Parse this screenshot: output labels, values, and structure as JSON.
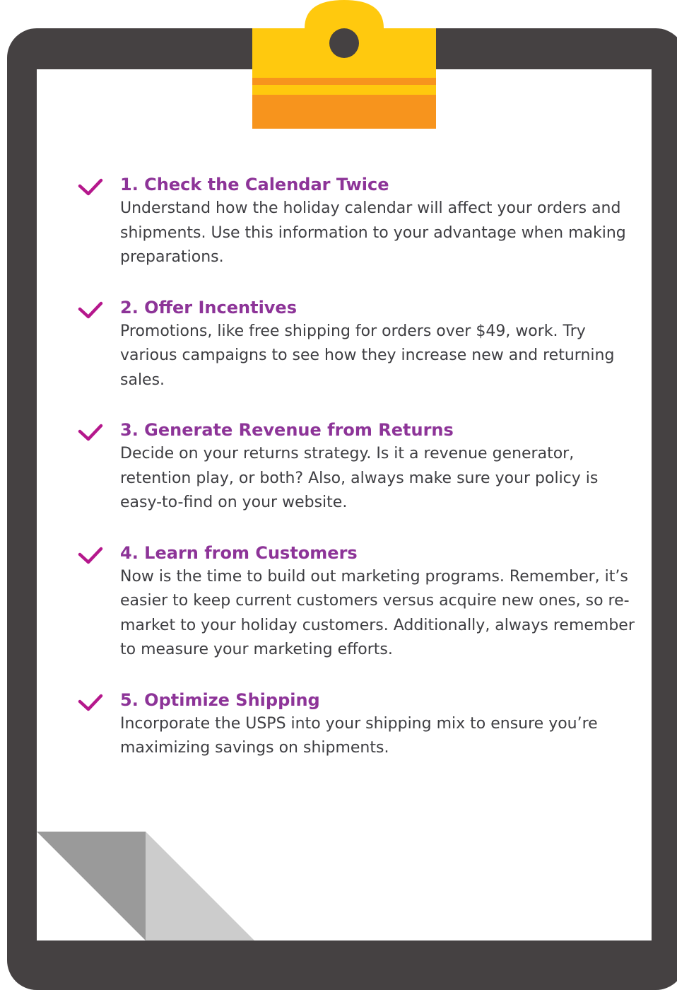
{
  "colors": {
    "board": "#454142",
    "paper": "#ffffff",
    "clip_yellow": "#ffc90e",
    "clip_orange": "#f7941d",
    "title_purple": "#8d3498",
    "check_magenta": "#b5178c",
    "body_text": "#3e3e42",
    "fold_dark": "#9a9a9a",
    "fold_light": "#cccccc"
  },
  "icons": {
    "check": "checkmark-icon"
  },
  "checklist": [
    {
      "title": "1. Check the Calendar Twice",
      "body": "Understand how the holiday calendar will affect your orders and shipments. Use this information to your advantage when making preparations."
    },
    {
      "title": "2. Offer Incentives",
      "body": "Promotions, like free shipping for orders over $49, work. Try various campaigns to see how they increase new and returning sales."
    },
    {
      "title": "3. Generate Revenue from Returns",
      "body": "Decide on your returns strategy. Is it a revenue generator, retention play, or both? Also, always make sure your policy is easy-to-find on your website."
    },
    {
      "title": "4. Learn from Customers",
      "body": "Now is the time to build out marketing programs. Remember, it’s easier to keep current customers versus acquire new ones, so re-market to your holiday customers. Additionally, always remember to measure your marketing efforts."
    },
    {
      "title": "5. Optimize Shipping",
      "body": "Incorporate the USPS into your shipping mix to ensure you’re maximizing savings on shipments."
    }
  ]
}
